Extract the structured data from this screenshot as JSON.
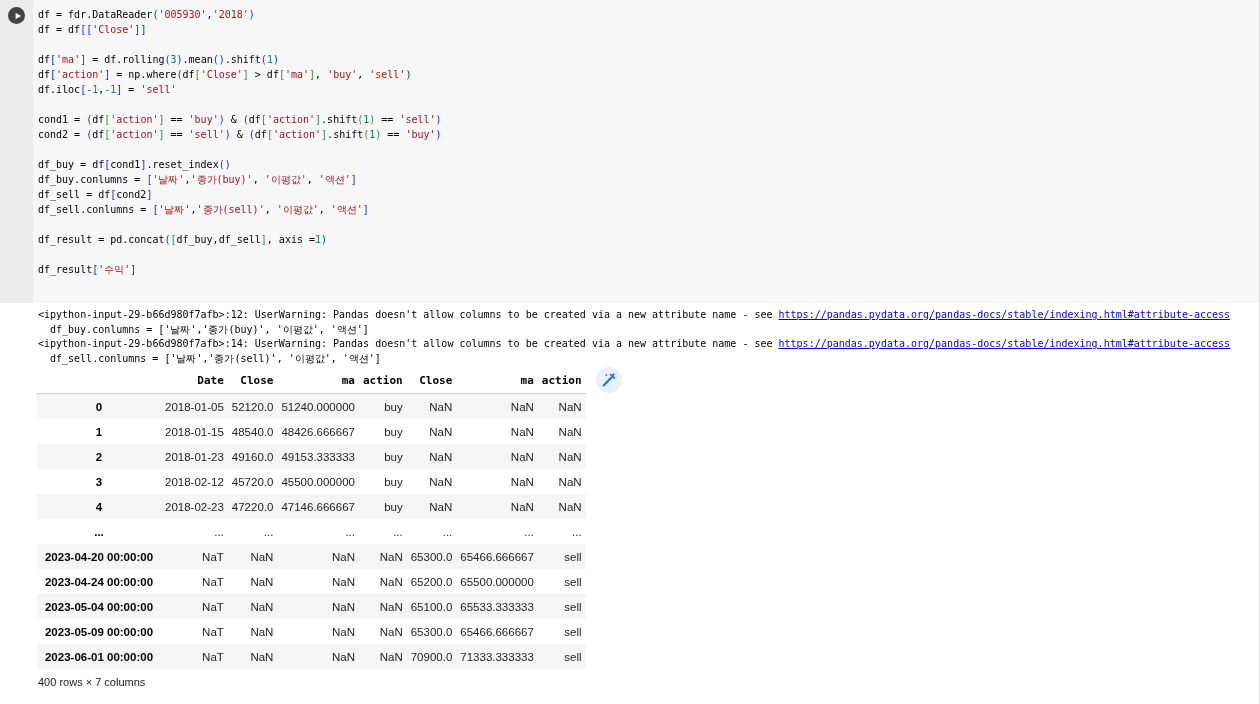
{
  "code_blocks": [
    [
      [
        {
          "text": "df = fdr.DataReader",
          "kind": "text"
        },
        {
          "text": "(",
          "kind": "b1"
        },
        {
          "text": "'005930'",
          "kind": "str"
        },
        {
          "text": ",",
          "kind": "text"
        },
        {
          "text": "'2018'",
          "kind": "str"
        },
        {
          "text": ")",
          "kind": "b1"
        }
      ],
      [
        {
          "text": "df = df",
          "kind": "text"
        },
        {
          "text": "[[",
          "kind": "b1"
        },
        {
          "text": "'Close'",
          "kind": "str"
        },
        {
          "text": "]]",
          "kind": "b1"
        }
      ]
    ],
    [
      [
        {
          "text": "df",
          "kind": "text"
        },
        {
          "text": "[",
          "kind": "b1"
        },
        {
          "text": "'ma'",
          "kind": "str"
        },
        {
          "text": "]",
          "kind": "b1"
        },
        {
          "text": " = df.rolling",
          "kind": "text"
        },
        {
          "text": "(",
          "kind": "b1"
        },
        {
          "text": "3",
          "kind": "num"
        },
        {
          "text": ")",
          "kind": "b1"
        },
        {
          "text": ".mean",
          "kind": "text"
        },
        {
          "text": "()",
          "kind": "b1"
        },
        {
          "text": ".shift",
          "kind": "text"
        },
        {
          "text": "(",
          "kind": "b1"
        },
        {
          "text": "1",
          "kind": "num"
        },
        {
          "text": ")",
          "kind": "b1"
        }
      ],
      [
        {
          "text": "df",
          "kind": "text"
        },
        {
          "text": "[",
          "kind": "b1"
        },
        {
          "text": "'action'",
          "kind": "str"
        },
        {
          "text": "]",
          "kind": "b1"
        },
        {
          "text": " = np.where",
          "kind": "text"
        },
        {
          "text": "(",
          "kind": "b1"
        },
        {
          "text": "df",
          "kind": "text"
        },
        {
          "text": "[",
          "kind": "b2"
        },
        {
          "text": "'Close'",
          "kind": "str"
        },
        {
          "text": "]",
          "kind": "b2"
        },
        {
          "text": " > df",
          "kind": "text"
        },
        {
          "text": "[",
          "kind": "b2"
        },
        {
          "text": "'ma'",
          "kind": "str"
        },
        {
          "text": "]",
          "kind": "b2"
        },
        {
          "text": ", ",
          "kind": "text"
        },
        {
          "text": "'buy'",
          "kind": "str"
        },
        {
          "text": ", ",
          "kind": "text"
        },
        {
          "text": "'sell'",
          "kind": "str"
        },
        {
          "text": ")",
          "kind": "b1"
        }
      ],
      [
        {
          "text": "df.iloc",
          "kind": "text"
        },
        {
          "text": "[",
          "kind": "b1"
        },
        {
          "text": "-1",
          "kind": "num"
        },
        {
          "text": ",",
          "kind": "text"
        },
        {
          "text": "-1",
          "kind": "num"
        },
        {
          "text": "]",
          "kind": "b1"
        },
        {
          "text": " = ",
          "kind": "text"
        },
        {
          "text": "'sell'",
          "kind": "str"
        }
      ]
    ],
    [
      [
        {
          "text": "cond1 = ",
          "kind": "text"
        },
        {
          "text": "(",
          "kind": "b1"
        },
        {
          "text": "df",
          "kind": "text"
        },
        {
          "text": "[",
          "kind": "b2"
        },
        {
          "text": "'action'",
          "kind": "str"
        },
        {
          "text": "]",
          "kind": "b2"
        },
        {
          "text": " == ",
          "kind": "text"
        },
        {
          "text": "'buy'",
          "kind": "str"
        },
        {
          "text": ")",
          "kind": "b1"
        },
        {
          "text": " & ",
          "kind": "text"
        },
        {
          "text": "(",
          "kind": "b1"
        },
        {
          "text": "df",
          "kind": "text"
        },
        {
          "text": "[",
          "kind": "b2"
        },
        {
          "text": "'action'",
          "kind": "str"
        },
        {
          "text": "]",
          "kind": "b2"
        },
        {
          "text": ".shift",
          "kind": "text"
        },
        {
          "text": "(",
          "kind": "b2"
        },
        {
          "text": "1",
          "kind": "num"
        },
        {
          "text": ")",
          "kind": "b2"
        },
        {
          "text": " == ",
          "kind": "text"
        },
        {
          "text": "'sell'",
          "kind": "str"
        },
        {
          "text": ")",
          "kind": "b1"
        }
      ],
      [
        {
          "text": "cond2 = ",
          "kind": "text"
        },
        {
          "text": "(",
          "kind": "b1"
        },
        {
          "text": "df",
          "kind": "text"
        },
        {
          "text": "[",
          "kind": "b2"
        },
        {
          "text": "'action'",
          "kind": "str"
        },
        {
          "text": "]",
          "kind": "b2"
        },
        {
          "text": " == ",
          "kind": "text"
        },
        {
          "text": "'sell'",
          "kind": "str"
        },
        {
          "text": ")",
          "kind": "b1"
        },
        {
          "text": " & ",
          "kind": "text"
        },
        {
          "text": "(",
          "kind": "b1"
        },
        {
          "text": "df",
          "kind": "text"
        },
        {
          "text": "[",
          "kind": "b2"
        },
        {
          "text": "'action'",
          "kind": "str"
        },
        {
          "text": "]",
          "kind": "b2"
        },
        {
          "text": ".shift",
          "kind": "text"
        },
        {
          "text": "(",
          "kind": "b2"
        },
        {
          "text": "1",
          "kind": "num"
        },
        {
          "text": ")",
          "kind": "b2"
        },
        {
          "text": " == ",
          "kind": "text"
        },
        {
          "text": "'buy'",
          "kind": "str"
        },
        {
          "text": ")",
          "kind": "b1"
        }
      ]
    ],
    [
      [
        {
          "text": "df_buy = df",
          "kind": "text"
        },
        {
          "text": "[",
          "kind": "b1"
        },
        {
          "text": "cond1",
          "kind": "text"
        },
        {
          "text": "]",
          "kind": "b1"
        },
        {
          "text": ".reset_index",
          "kind": "text"
        },
        {
          "text": "()",
          "kind": "b1"
        }
      ],
      [
        {
          "text": "df_buy.conlumns = ",
          "kind": "text"
        },
        {
          "text": "[",
          "kind": "b1"
        },
        {
          "text": "'날짜'",
          "kind": "str"
        },
        {
          "text": ",",
          "kind": "text"
        },
        {
          "text": "'종가(buy)'",
          "kind": "str"
        },
        {
          "text": ", ",
          "kind": "text"
        },
        {
          "text": "'이평값'",
          "kind": "str"
        },
        {
          "text": ", ",
          "kind": "text"
        },
        {
          "text": "'액션'",
          "kind": "str"
        },
        {
          "text": "]",
          "kind": "b1"
        }
      ],
      [
        {
          "text": "df_sell = df",
          "kind": "text"
        },
        {
          "text": "[",
          "kind": "b1"
        },
        {
          "text": "cond2",
          "kind": "text"
        },
        {
          "text": "]",
          "kind": "b1"
        }
      ],
      [
        {
          "text": "df_sell.conlumns = ",
          "kind": "text"
        },
        {
          "text": "[",
          "kind": "b1"
        },
        {
          "text": "'날짜'",
          "kind": "str"
        },
        {
          "text": ",",
          "kind": "text"
        },
        {
          "text": "'종가(sell)'",
          "kind": "str"
        },
        {
          "text": ", ",
          "kind": "text"
        },
        {
          "text": "'이평값'",
          "kind": "str"
        },
        {
          "text": ", ",
          "kind": "text"
        },
        {
          "text": "'액션'",
          "kind": "str"
        },
        {
          "text": "]",
          "kind": "b1"
        }
      ]
    ],
    [
      [
        {
          "text": "df_result = pd.concat",
          "kind": "text"
        },
        {
          "text": "(",
          "kind": "b1"
        },
        {
          "text": "[",
          "kind": "b2"
        },
        {
          "text": "df_buy,df_sell",
          "kind": "text"
        },
        {
          "text": "]",
          "kind": "b2"
        },
        {
          "text": ", axis =",
          "kind": "text"
        },
        {
          "text": "1",
          "kind": "num"
        },
        {
          "text": ")",
          "kind": "b1"
        }
      ]
    ],
    [
      [
        {
          "text": "df_result",
          "kind": "text"
        },
        {
          "text": "[",
          "kind": "b1"
        },
        {
          "text": "'수익'",
          "kind": "str"
        },
        {
          "text": "]",
          "kind": "b1"
        }
      ]
    ]
  ],
  "warnings": [
    {
      "message": "<ipython-input-29-b66d980f7afb>:12: UserWarning: Pandas doesn't allow columns to be created via a new attribute name - see ",
      "link": "https://pandas.pydata.org/pandas-docs/stable/indexing.html#attribute-access",
      "source": "df_buy.conlumns = ['날짜','종가(buy)', '이평값', '액션']"
    },
    {
      "message": "<ipython-input-29-b66d980f7afb>:14: UserWarning: Pandas doesn't allow columns to be created via a new attribute name - see ",
      "link": "https://pandas.pydata.org/pandas-docs/stable/indexing.html#attribute-access",
      "source": "df_sell.conlumns = ['날짜','종가(sell)', '이평값', '액션']"
    }
  ],
  "table": {
    "columns": [
      "Date",
      "Close",
      "ma",
      "action",
      "Close",
      "ma",
      "action"
    ],
    "rows": [
      {
        "index": "0",
        "cells": [
          "2018-01-05",
          "52120.0",
          "51240.000000",
          "buy",
          "NaN",
          "NaN",
          "NaN"
        ]
      },
      {
        "index": "1",
        "cells": [
          "2018-01-15",
          "48540.0",
          "48426.666667",
          "buy",
          "NaN",
          "NaN",
          "NaN"
        ]
      },
      {
        "index": "2",
        "cells": [
          "2018-01-23",
          "49160.0",
          "49153.333333",
          "buy",
          "NaN",
          "NaN",
          "NaN"
        ]
      },
      {
        "index": "3",
        "cells": [
          "2018-02-12",
          "45720.0",
          "45500.000000",
          "buy",
          "NaN",
          "NaN",
          "NaN"
        ]
      },
      {
        "index": "4",
        "cells": [
          "2018-02-23",
          "47220.0",
          "47146.666667",
          "buy",
          "NaN",
          "NaN",
          "NaN"
        ]
      },
      {
        "index": "...",
        "cells": [
          "...",
          "...",
          "...",
          "...",
          "...",
          "...",
          "..."
        ]
      },
      {
        "index": "2023-04-20 00:00:00",
        "cells": [
          "NaT",
          "NaN",
          "NaN",
          "NaN",
          "65300.0",
          "65466.666667",
          "sell"
        ]
      },
      {
        "index": "2023-04-24 00:00:00",
        "cells": [
          "NaT",
          "NaN",
          "NaN",
          "NaN",
          "65200.0",
          "65500.000000",
          "sell"
        ]
      },
      {
        "index": "2023-05-04 00:00:00",
        "cells": [
          "NaT",
          "NaN",
          "NaN",
          "NaN",
          "65100.0",
          "65533.333333",
          "sell"
        ]
      },
      {
        "index": "2023-05-09 00:00:00",
        "cells": [
          "NaT",
          "NaN",
          "NaN",
          "NaN",
          "65300.0",
          "65466.666667",
          "sell"
        ]
      },
      {
        "index": "2023-06-01 00:00:00",
        "cells": [
          "NaT",
          "NaN",
          "NaN",
          "NaN",
          "70900.0",
          "71333.333333",
          "sell"
        ]
      }
    ],
    "footer": "400 rows × 7 columns"
  }
}
